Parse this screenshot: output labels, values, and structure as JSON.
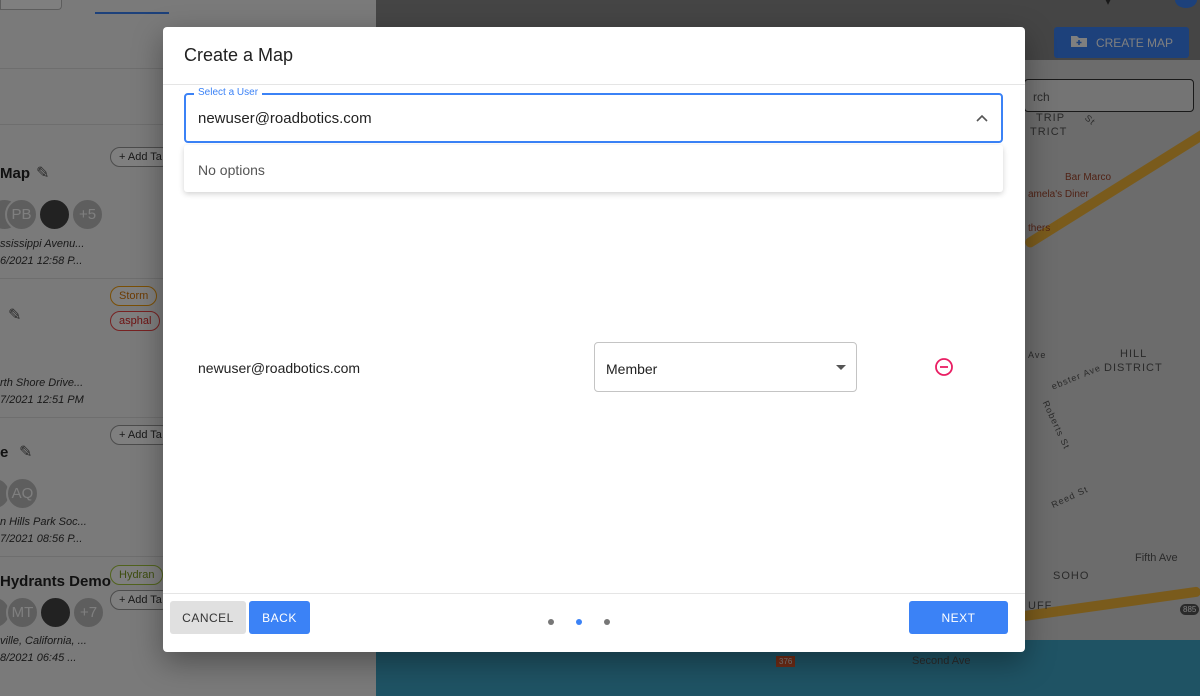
{
  "background": {
    "cards": [
      {
        "title": "Map",
        "tag": "+ Add Ta",
        "avatars": [
          "",
          "PB",
          "",
          "+5"
        ],
        "meta": [
          "ssissippi Avenu...",
          "6/2021 12:58 P..."
        ]
      },
      {
        "title": "",
        "tags": [
          "Storm",
          "asphal"
        ],
        "meta": [
          "rth Shore Drive...",
          "7/2021 12:51 PM"
        ]
      },
      {
        "title": "e",
        "tag": "+ Add Ta",
        "avatars": [
          "",
          "AQ"
        ],
        "meta": [
          "n Hills Park Soc...",
          "7/2021 08:56 P..."
        ]
      },
      {
        "title": "Hydrants Demo",
        "tags": [
          "Hydran",
          "+ Add Ta"
        ],
        "avatars": [
          "",
          "MT",
          "",
          "+7"
        ],
        "meta": [
          "ville, California, ...",
          "8/2021 06:45 ..."
        ]
      }
    ],
    "create_map_label": "CREATE MAP",
    "map_search_placeholder": "rch",
    "map_labels": {
      "strip_district": "TRIP",
      "strip_district_2": "TRICT",
      "bar_marco": "Bar Marco",
      "pamelas": "amela's Diner",
      "others": "thers",
      "hill_district": "HILL",
      "hill_district_2": "DISTRICT",
      "ave": "Ave",
      "webster": "ebster Ave",
      "roberts": "Roberts St",
      "reed": "Reed St",
      "fifth": "Fifth Ave",
      "soho": "SOHO",
      "bluff": "UFF",
      "second_ave": "Second Ave",
      "st": "St",
      "i376": "376",
      "r885": "885"
    }
  },
  "modal": {
    "title": "Create a Map",
    "select_user": {
      "legend": "Select a User",
      "value": "newuser@roadbotics.com",
      "no_options": "No options"
    },
    "users": [
      {
        "email": "newuser@roadbotics.com",
        "role": "Member"
      }
    ],
    "buttons": {
      "cancel": "CANCEL",
      "back": "BACK",
      "next": "NEXT"
    },
    "steps": {
      "total": 3,
      "current": 2
    }
  },
  "colors": {
    "primary": "#3b82f6",
    "remove": "#e91e63"
  }
}
